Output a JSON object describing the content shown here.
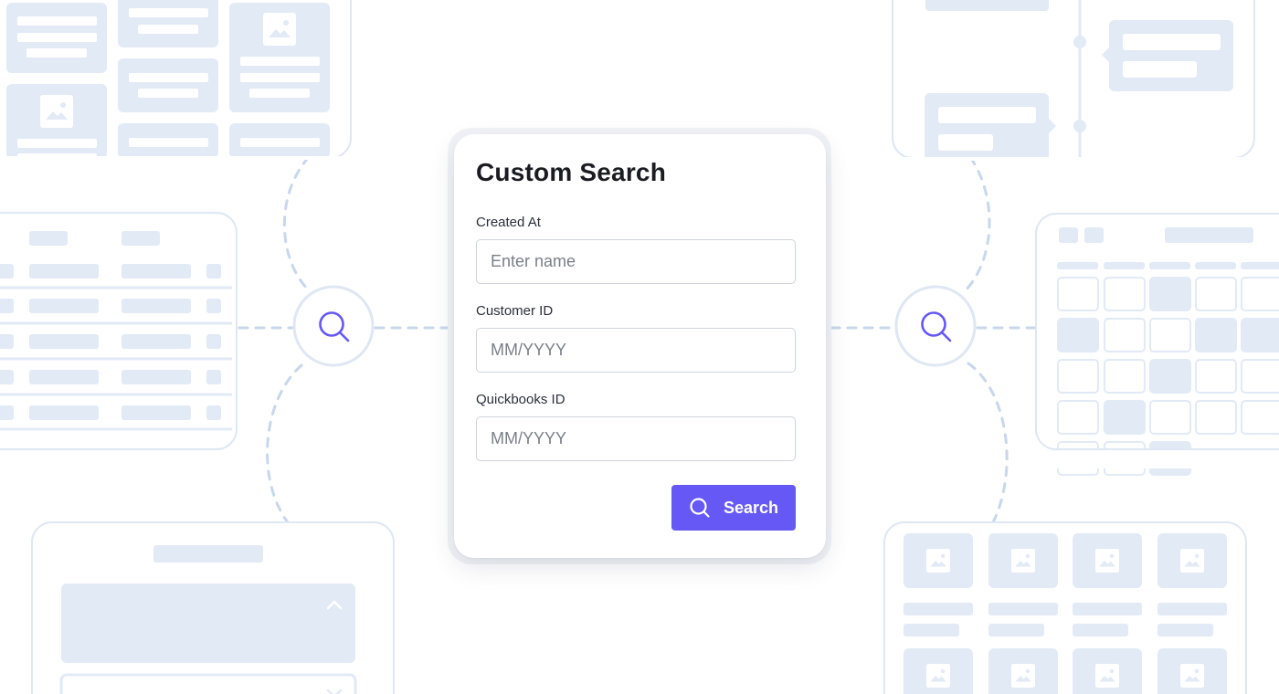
{
  "colors": {
    "accent": "#6558f5",
    "skeleton": "#e2eaf6",
    "outline": "#dfe7f3",
    "connector": "#c9d7ec",
    "title": "#1b1b22"
  },
  "search_form": {
    "title": "Custom Search",
    "fields": [
      {
        "label": "Created At",
        "placeholder": "Enter name"
      },
      {
        "label": "Customer ID",
        "placeholder": "MM/YYYY"
      },
      {
        "label": "Quickbooks ID",
        "placeholder": "MM/YYYY"
      }
    ],
    "search_button": {
      "label": "Search",
      "icon": "search-icon"
    }
  },
  "background": {
    "left_connector_icon": "magnifier-icon",
    "right_connector_icon": "magnifier-icon",
    "mock_panels": [
      "image-grid-mock",
      "table-mock",
      "accordion-mock",
      "timeline-mock",
      "calendar-mock",
      "gallery-mock"
    ]
  }
}
